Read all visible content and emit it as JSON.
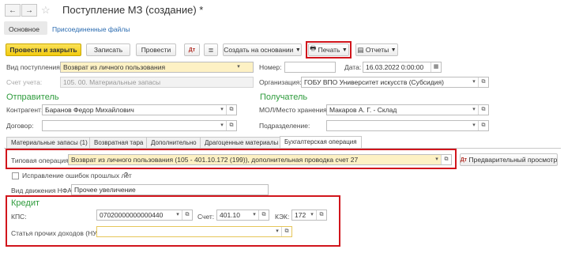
{
  "window": {
    "title": "Поступление МЗ (создание)",
    "modified_mark": "*"
  },
  "nav": {
    "back_icon": "arrow-left",
    "forward_icon": "arrow-right",
    "favorite_icon": "star"
  },
  "top_tabs": {
    "main": "Основное",
    "files": "Присоединенные файлы"
  },
  "toolbar": {
    "post_close": "Провести и закрыть",
    "save": "Записать",
    "post": "Провести",
    "create_based": "Создать на основании",
    "print": "Печать",
    "reports": "Отчеты"
  },
  "form": {
    "receipt_type_label": "Вид поступления:",
    "receipt_type_value": "Возврат из личного пользования",
    "number_label": "Номер:",
    "number_value": "",
    "date_label": "Дата:",
    "date_value": "16.03.2022  0:00:00",
    "account_label": "Счет учета:",
    "account_value": "105. 00. Материальные запасы",
    "org_label": "Организация:",
    "org_value": "ГОБУ ВПО Университет искусств (Субсидия)"
  },
  "sender": {
    "title": "Отправитель",
    "counterparty_label": "Контрагент:",
    "counterparty_value": "Баранов Федор Михайлович",
    "contract_label": "Договор:",
    "contract_value": ""
  },
  "receiver": {
    "title": "Получатель",
    "mol_label": "МОЛ/Место хранения:",
    "mol_value": "Макаров А. Г. - Склад",
    "division_label": "Подразделение:",
    "division_value": ""
  },
  "tabs": [
    "Материальные запасы (1)",
    "Возвратная тара",
    "Дополнительно",
    "Драгоценные материалы",
    "Бухгалтерская операция"
  ],
  "accounting": {
    "typical_op_label": "Типовая операция:",
    "typical_op_value": "Возврат из личного пользования (105 - 401.10.172 (199)), дополнительная проводка счет 27",
    "preview_button": "Предварительный просмотр",
    "fix_errors_label": "Исправление ошибок прошлых лет",
    "help_mark": "?",
    "nfa_movement_label": "Вид движения НФА:",
    "nfa_movement_value": "Прочее увеличение"
  },
  "credit": {
    "title": "Кредит",
    "kps_label": "КПС:",
    "kps_value": "07020000000000440",
    "account_label": "Счет:",
    "account_value": "401.10",
    "kek_label": "КЭК:",
    "kek_value": "172",
    "other_income_label": "Статья прочих доходов (НУ):",
    "other_income_value": ""
  },
  "colors": {
    "highlight": "#d1151c",
    "section": "#2e9b3c",
    "primary_button": "#f2cb0f",
    "link": "#2a6bb0"
  }
}
